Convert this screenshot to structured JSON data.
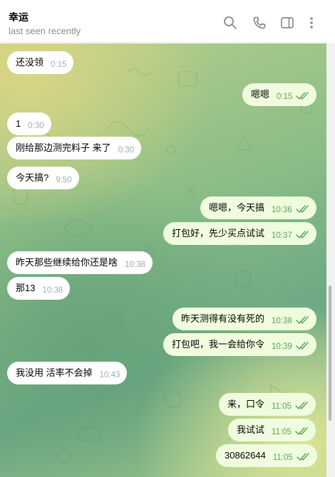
{
  "header": {
    "contact_name": "幸运",
    "status": "last seen recently",
    "icons": [
      "search-icon",
      "phone-icon",
      "sidebar-icon",
      "more-icon"
    ]
  },
  "colors": {
    "incoming_bubble": "#ffffff",
    "outgoing_bubble": "#effdde",
    "outgoing_time": "#5aa35c",
    "incoming_time": "#a0acb6"
  },
  "messages": [
    {
      "text": "还没领",
      "time": "0:15",
      "direction": "in"
    },
    {
      "text": "嗯嗯",
      "time": "0:15",
      "direction": "out",
      "read": true
    },
    {
      "text": "1",
      "time": "0:30",
      "direction": "in"
    },
    {
      "text": "刚给那边测完料子 来了",
      "time": "0:30",
      "direction": "in"
    },
    {
      "text": "今天搞?",
      "time": "9:50",
      "direction": "in"
    },
    {
      "text": "嗯嗯，今天搞",
      "time": "10:36",
      "direction": "out",
      "read": true
    },
    {
      "text": "打包好，先少买点试试",
      "time": "10:37",
      "direction": "out",
      "read": true
    },
    {
      "text": "昨天那些继续给你还是啥",
      "time": "10:38",
      "direction": "in"
    },
    {
      "text": "那13",
      "time": "10:38",
      "direction": "in"
    },
    {
      "text": "昨天测得有没有死的",
      "time": "10:38",
      "direction": "out",
      "read": true
    },
    {
      "text": "打包吧，我一会给你令",
      "time": "10:39",
      "direction": "out",
      "read": true
    },
    {
      "text": "我没用 活率不会掉",
      "time": "10:43",
      "direction": "in"
    },
    {
      "text": "来，口令",
      "time": "11:05",
      "direction": "out",
      "read": true
    },
    {
      "text": "我试试",
      "time": "11:05",
      "direction": "out",
      "read": true
    },
    {
      "text": "30862644",
      "time": "11:05",
      "direction": "out",
      "read": true
    }
  ]
}
